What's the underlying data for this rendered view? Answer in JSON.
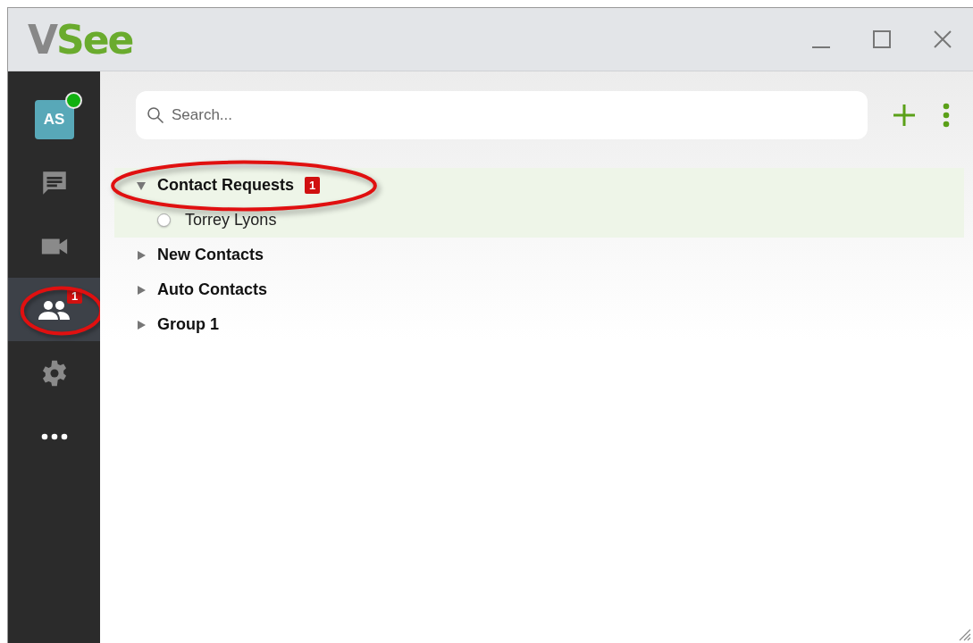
{
  "window": {
    "logo_parts": [
      "V",
      "See"
    ],
    "controls": [
      {
        "kind": "minimize"
      },
      {
        "kind": "maximize"
      },
      {
        "kind": "close"
      }
    ]
  },
  "user": {
    "initials": "AS",
    "online": true
  },
  "sidebar": {
    "items": [
      {
        "kind": "chat",
        "selected": false,
        "circled": false
      },
      {
        "kind": "video",
        "selected": false,
        "circled": false
      },
      {
        "kind": "contacts",
        "selected": true,
        "badge": "1",
        "circled": true
      },
      {
        "kind": "settings",
        "selected": false,
        "circled": false
      },
      {
        "kind": "more",
        "selected": false,
        "circled": false
      }
    ]
  },
  "search": {
    "placeholder": "Search..."
  },
  "tree": [
    {
      "label": "Contact Requests",
      "expanded": true,
      "selected": true,
      "badge": "1",
      "circled": true,
      "children": [
        {
          "label": "Torrey Lyons",
          "checked": false
        }
      ]
    },
    {
      "label": "New Contacts",
      "expanded": false,
      "selected": false,
      "circled": false
    },
    {
      "label": "Auto Contacts",
      "expanded": false,
      "selected": false,
      "circled": false
    },
    {
      "label": "Group 1",
      "expanded": false,
      "selected": false,
      "circled": false
    }
  ]
}
